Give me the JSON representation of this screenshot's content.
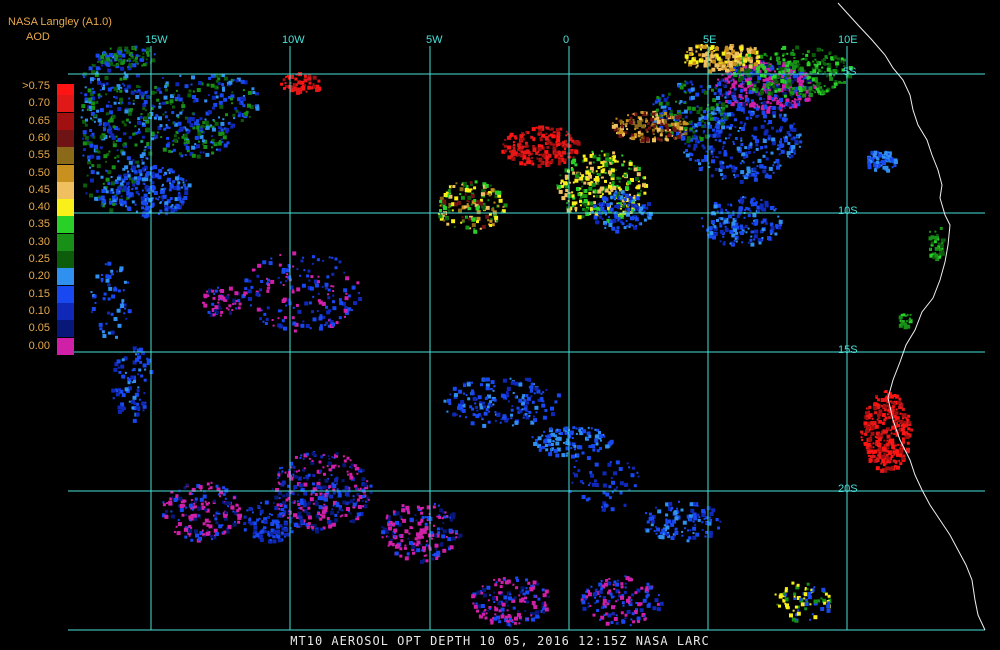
{
  "header": {
    "source": "NASA Langley (A1.0)",
    "product": "AOD"
  },
  "legend": {
    "entries": [
      {
        "label": ">0.75",
        "color": "#ff1414"
      },
      {
        "label": "0.70",
        "color": "#e01818"
      },
      {
        "label": "0.65",
        "color": "#a01010"
      },
      {
        "label": "0.60",
        "color": "#6e1414"
      },
      {
        "label": "0.55",
        "color": "#8a6a18"
      },
      {
        "label": "0.50",
        "color": "#c8901e"
      },
      {
        "label": "0.45",
        "color": "#f0c060"
      },
      {
        "label": "0.40",
        "color": "#f8f018"
      },
      {
        "label": "0.35",
        "color": "#28d028"
      },
      {
        "label": "0.30",
        "color": "#189018"
      },
      {
        "label": "0.25",
        "color": "#0c5c0c"
      },
      {
        "label": "0.20",
        "color": "#3090f0"
      },
      {
        "label": "0.15",
        "color": "#1848f0"
      },
      {
        "label": "0.10",
        "color": "#1028b8"
      },
      {
        "label": "0.05",
        "color": "#081878"
      },
      {
        "label": "0.00",
        "color": "#d020a8"
      }
    ]
  },
  "grid": {
    "color": "#48e0d8",
    "longitude_labels": [
      "15W",
      "10W",
      "5W",
      "0",
      "5E",
      "10E"
    ],
    "latitude_labels": [
      "5S",
      "10S",
      "15S",
      "20S"
    ]
  },
  "coastline_color": "#f0f0f0",
  "footer": {
    "text": "MT10  AEROSOL OPT DEPTH   10 05, 2016 12:15Z   NASA LARC"
  }
}
